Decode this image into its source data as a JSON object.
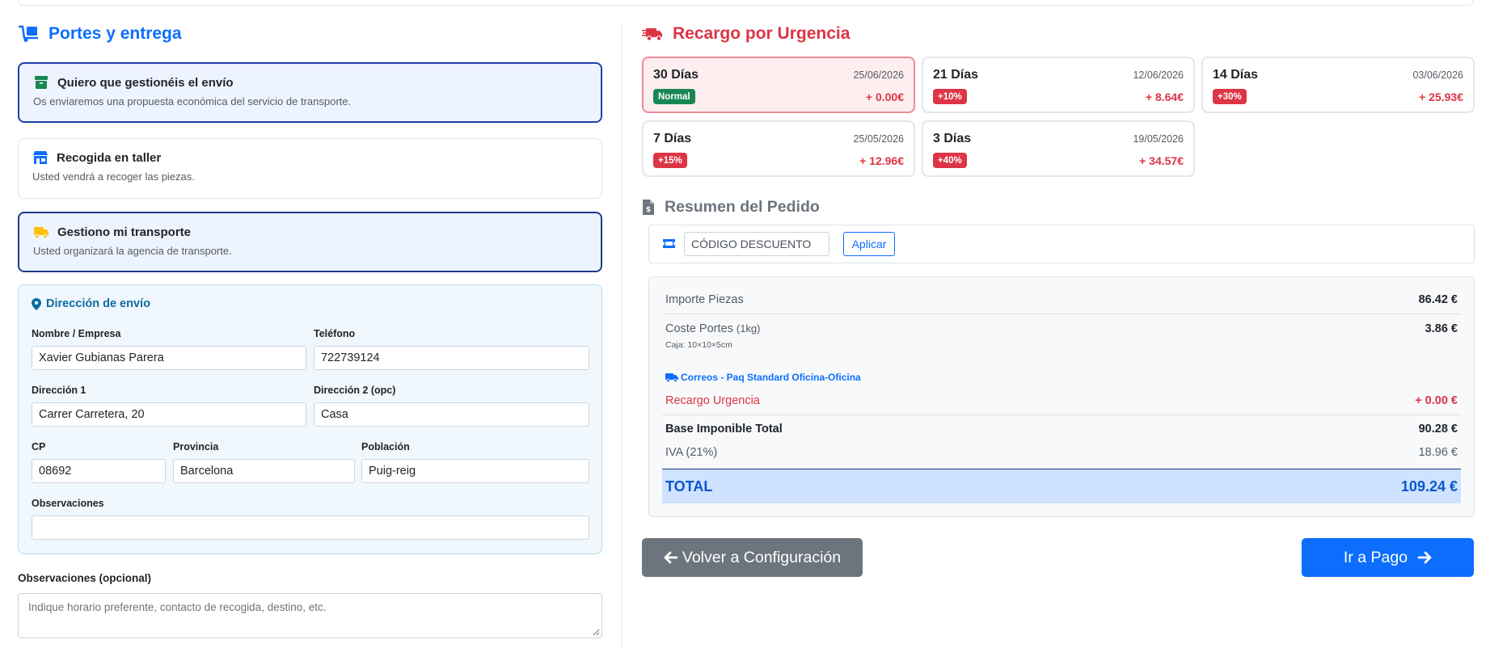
{
  "shipping": {
    "title": "Portes y entrega",
    "options": [
      {
        "label": "Quiero que gestionéis el envío",
        "desc": "Os enviaremos una propuesta económica del servicio de transporte.",
        "icon": "box-icon"
      },
      {
        "label": "Recogida en taller",
        "desc": "Usted vendrá a recoger las piezas.",
        "icon": "shop-icon"
      },
      {
        "label": "Gestiono mi transporte",
        "desc": "Usted organizará la agencia de transporte.",
        "icon": "truck-icon"
      }
    ]
  },
  "address": {
    "title": "Dirección de envío",
    "name_label": "Nombre / Empresa",
    "name_value": "Xavier Gubianas Parera",
    "phone_label": "Teléfono",
    "phone_value": "722739124",
    "addr1_label": "Dirección 1",
    "addr1_value": "Carrer Carretera, 20",
    "addr2_label": "Dirección 2 (opc)",
    "addr2_value": "Casa",
    "cp_label": "CP",
    "cp_value": "08692",
    "province_label": "Provincia",
    "province_value": "Barcelona",
    "town_label": "Población",
    "town_value": "Puig-reig",
    "notes_label": "Observaciones",
    "notes_value": ""
  },
  "observations": {
    "label": "Observaciones (opcional)",
    "placeholder": "Indique horario preferente, contacto de recogida, destino, etc."
  },
  "urgency": {
    "title": "Recargo por Urgencia",
    "options": [
      {
        "days": "30 Días",
        "date": "25/06/2026",
        "badge": "Normal",
        "surcharge": "+ 0.00€"
      },
      {
        "days": "21 Días",
        "date": "12/06/2026",
        "badge": "+10%",
        "surcharge": "+ 8.64€"
      },
      {
        "days": "14 Días",
        "date": "03/06/2026",
        "badge": "+30%",
        "surcharge": "+ 25.93€"
      },
      {
        "days": "7 Días",
        "date": "25/05/2026",
        "badge": "+15%",
        "surcharge": "+ 12.96€"
      },
      {
        "days": "3 Días",
        "date": "19/05/2026",
        "badge": "+40%",
        "surcharge": "+ 34.57€"
      }
    ]
  },
  "summary": {
    "title": "Resumen del Pedido",
    "discount_placeholder": "CÓDIGO DESCUENTO",
    "apply_label": "Aplicar",
    "parts_label": "Importe Piezas",
    "parts_value": "86.42 €",
    "shipping_label": "Coste Portes",
    "shipping_weight": "(1kg)",
    "box_label": "Caja: 10×10×5cm",
    "shipping_value": "3.86 €",
    "carrier": "Correos - Paq Standard Oficina-Oficina",
    "urgency_label": "Recargo Urgencia",
    "urgency_value": "+ 0.00 €",
    "base_label": "Base Imponible Total",
    "base_value": "90.28 €",
    "iva_label": "IVA (21%)",
    "iva_value": "18.96 €",
    "total_label": "TOTAL",
    "total_value": "109.24 €"
  },
  "actions": {
    "back_label": "Volver a Configuración",
    "pay_label": "Ir a Pago"
  },
  "colors": {
    "primary": "#0d6efd",
    "danger": "#dc3545",
    "success": "#198754",
    "secondary": "#6c757d"
  }
}
